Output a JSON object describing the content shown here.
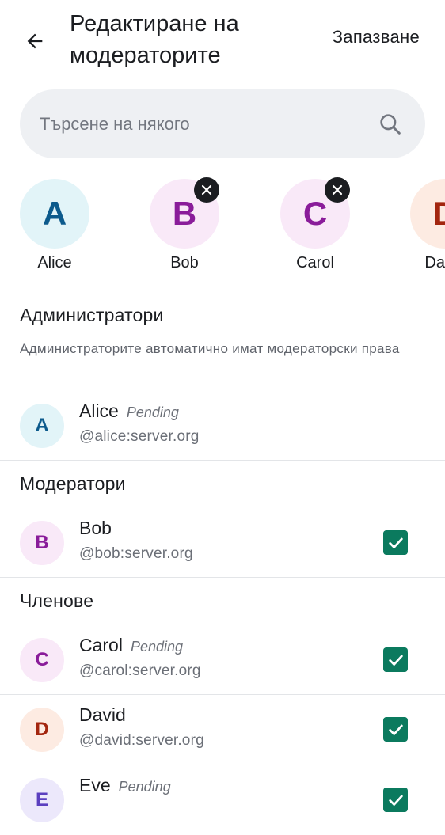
{
  "header": {
    "title": "Редактиране на модераторите",
    "save_label": "Запазване"
  },
  "search": {
    "placeholder": "Търсене на някого"
  },
  "selected_chips": [
    {
      "initial": "A",
      "name": "Alice",
      "removable": false
    },
    {
      "initial": "B",
      "name": "Bob",
      "removable": true
    },
    {
      "initial": "C",
      "name": "Carol",
      "removable": true
    },
    {
      "initial": "D",
      "name": "David",
      "removable": false
    }
  ],
  "sections": {
    "admins": {
      "title": "Администратори",
      "description": "Администраторите автоматично имат модераторски права"
    },
    "moderators": {
      "title": "Модератори"
    },
    "members": {
      "title": "Членове"
    }
  },
  "users": {
    "alice": {
      "initial": "A",
      "name": "Alice",
      "badge": "Pending",
      "handle": "@alice:server.org"
    },
    "bob": {
      "initial": "B",
      "name": "Bob",
      "handle": "@bob:server.org",
      "checked": true
    },
    "carol": {
      "initial": "C",
      "name": "Carol",
      "badge": "Pending",
      "handle": "@carol:server.org",
      "checked": true
    },
    "david": {
      "initial": "D",
      "name": "David",
      "handle": "@david:server.org",
      "checked": true
    },
    "eve": {
      "initial": "E",
      "name": "Eve",
      "badge": "Pending",
      "checked": true
    }
  },
  "colors": {
    "accent_checkbox": "#0b7a5e",
    "search_bg": "#eef0f3",
    "avatar_a_bg": "#e2f4f8",
    "avatar_b_bg": "#f9e9f8",
    "avatar_d_bg": "#fdebe2"
  }
}
